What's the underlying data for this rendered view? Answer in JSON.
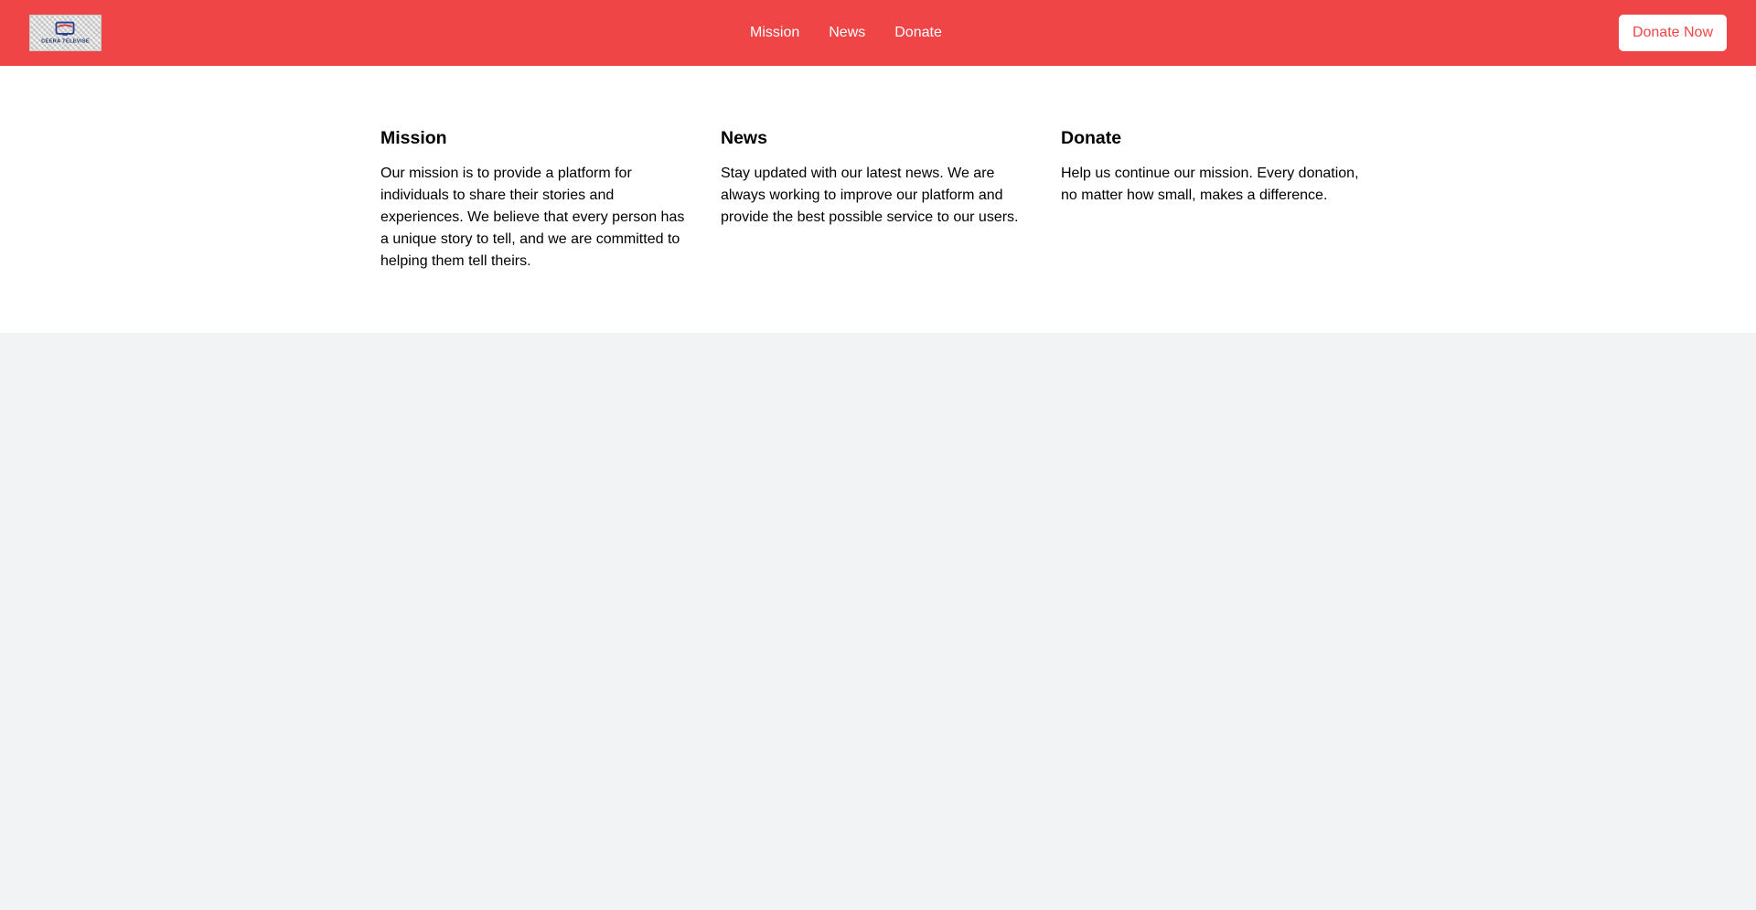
{
  "header": {
    "logo_text": "CEERA TELEVISE",
    "logo_icon": "tv-logo-icon",
    "nav": [
      {
        "label": "Mission"
      },
      {
        "label": "News"
      },
      {
        "label": "Donate"
      }
    ],
    "cta_label": "Donate Now",
    "colors": {
      "brand": "#f04547",
      "cta_bg": "#ffffff",
      "cta_text": "#f04547"
    }
  },
  "sections": [
    {
      "title": "Mission",
      "body": "Our mission is to provide a platform for individuals to share their stories and experiences. We believe that every person has a unique story to tell, and we are committed to helping them tell theirs."
    },
    {
      "title": "News",
      "body": "Stay updated with our latest news. We are always working to improve our platform and provide the best possible service to our users."
    },
    {
      "title": "Donate",
      "body": "Help us continue our mission. Every donation, no matter how small, makes a difference."
    }
  ],
  "page": {
    "background": "#f2f3f5",
    "content_background": "#ffffff"
  }
}
